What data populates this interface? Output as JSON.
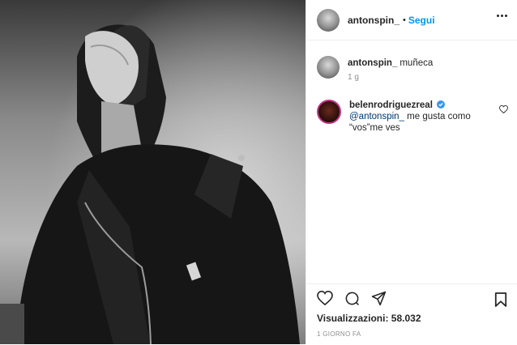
{
  "post": {
    "image_alt": "Black and white photo of a woman in a leather jacket looking upward"
  },
  "header": {
    "username": "antonspin_",
    "separator": "•",
    "follow_label": "Segui"
  },
  "caption": {
    "username": "antonspin_",
    "text": "muñeca",
    "time": "1 g"
  },
  "comment": {
    "username": "belenrodriguezreal",
    "mention": "@antonspin_",
    "text_line1": " me gusta como",
    "text_line2": "“vos”me ves"
  },
  "stats": {
    "views": "Visualizzazioni: 58.032",
    "posted": "1 GIORNO FA"
  },
  "colors": {
    "accent": "#0095f6",
    "verified": "#3897f0",
    "mention": "#00376b",
    "muted": "#8e8e8e"
  },
  "icons": [
    "more-icon",
    "verified-icon",
    "heart-icon",
    "like-icon",
    "comment-icon",
    "share-icon",
    "save-icon"
  ]
}
